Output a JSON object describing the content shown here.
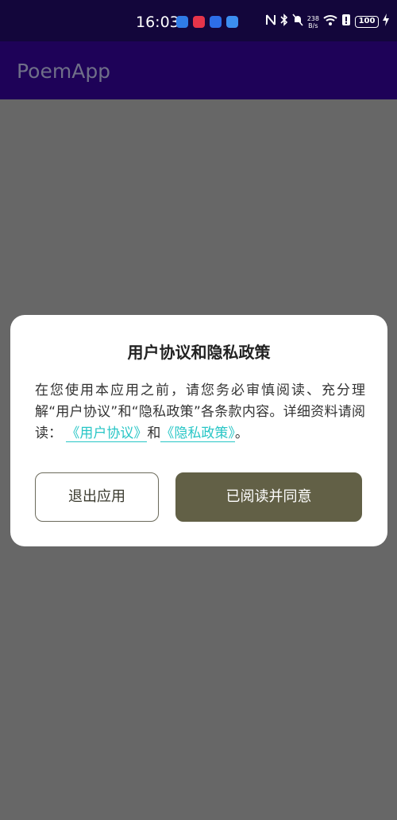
{
  "status_bar": {
    "time": "16:03",
    "net_speed_value": "238",
    "net_speed_unit": "B/s",
    "battery": "100",
    "notification_colors": [
      "#2f7be6",
      "#e6344a",
      "#2d6ee8",
      "#3c8ef0"
    ],
    "icons": [
      "nfc-icon",
      "bluetooth-icon",
      "mute-icon",
      "wifi-icon",
      "alert-icon",
      "charging-icon"
    ]
  },
  "app_bar": {
    "title": "PoemApp"
  },
  "dialog": {
    "title": "用户协议和隐私政策",
    "body_text": "在您使用本应用之前，请您务必审慎阅读、充分理解“用户协议”和“隐私政策”各条款内容。详细资料请阅读：",
    "link_user_agreement": "《用户协议》",
    "conjunction": "和",
    "link_privacy_policy": "《隐私政策》",
    "end_punct": "。",
    "exit_button": "退出应用",
    "agree_button": "已阅读并同意"
  },
  "colors": {
    "status_bar_bg": "#13063b",
    "app_bar_bg": "#1e0258",
    "scrim": "#676767",
    "link": "#28c6c6",
    "primary_button": "#626046"
  }
}
